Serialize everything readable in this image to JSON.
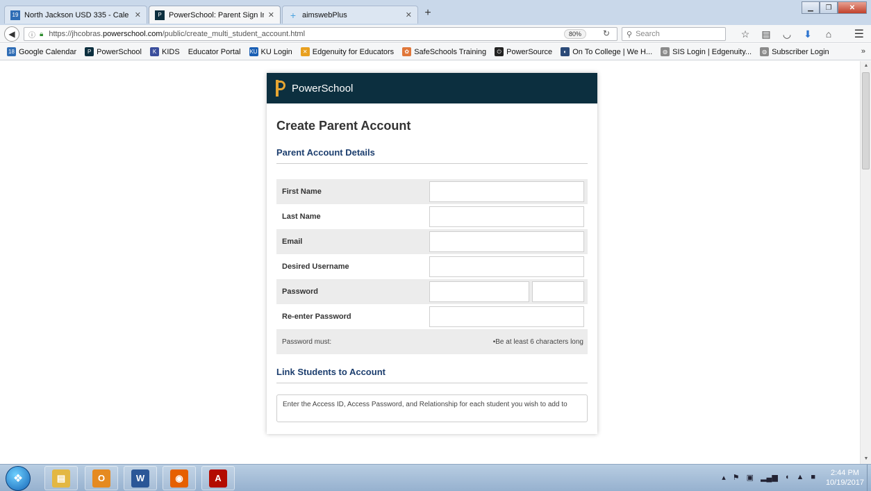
{
  "browser": {
    "tabs": [
      {
        "title": "North Jackson USD 335 - Cale",
        "favicon": "calendar-icon",
        "favicon_text": "19",
        "favicon_color": "#2f6db5",
        "active": false
      },
      {
        "title": "PowerSchool: Parent Sign In",
        "favicon": "powerschool-icon",
        "favicon_text": "P",
        "favicon_color": "#0c2f3f",
        "active": true
      },
      {
        "title": "aimswebPlus",
        "favicon": "aimsweb-icon",
        "favicon_text": "+",
        "favicon_color": "#4aa3df",
        "active": false
      }
    ],
    "new_tab_label": "+",
    "url_prefix": "https://jhcobras.",
    "url_domain": "powerschool.com",
    "url_path": "/public/create_multi_student_account.html",
    "zoom": "80%",
    "search_placeholder": "Search",
    "bookmarks": [
      {
        "label": "Google Calendar",
        "icon": "calendar-icon",
        "icon_text": "18",
        "color": "#2f6db5"
      },
      {
        "label": "PowerSchool",
        "icon": "powerschool-icon",
        "icon_text": "P",
        "color": "#0c2f3f"
      },
      {
        "label": "KIDS",
        "icon": "kids-icon",
        "icon_text": "K",
        "color": "#3a4e9c"
      },
      {
        "label": "Educator Portal",
        "icon": "",
        "icon_text": "",
        "color": ""
      },
      {
        "label": "KU Login",
        "icon": "ku-icon",
        "icon_text": "KU",
        "color": "#1a5fb4"
      },
      {
        "label": "Edgenuity for Educators",
        "icon": "edgenuity-icon",
        "icon_text": "✕",
        "color": "#e8a020"
      },
      {
        "label": "SafeSchools Training",
        "icon": "safeschools-icon",
        "icon_text": "✿",
        "color": "#e0773a"
      },
      {
        "label": "PowerSource",
        "icon": "power-icon",
        "icon_text": "⏻",
        "color": "#222222"
      },
      {
        "label": "On To College | We H...",
        "icon": "college-icon",
        "icon_text": "◐",
        "color": "#2b4a78"
      },
      {
        "label": "SIS Login | Edgenuity...",
        "icon": "globe-icon",
        "icon_text": "◍",
        "color": "#8a8a8a"
      },
      {
        "label": "Subscriber Login",
        "icon": "globe-icon",
        "icon_text": "◍",
        "color": "#8a8a8a"
      }
    ],
    "bookmarks_overflow": "»"
  },
  "page": {
    "brand": "PowerSchool",
    "title": "Create Parent Account",
    "section_account": "Parent Account Details",
    "fields": {
      "first_name": "First Name",
      "last_name": "Last Name",
      "email": "Email",
      "username": "Desired Username",
      "password": "Password",
      "reenter_password": "Re-enter Password"
    },
    "password_rules_label": "Password must:",
    "password_rules_text": "•Be at least 6 characters long",
    "section_students": "Link Students to Account",
    "students_info": "Enter the Access ID, Access Password, and Relationship for each student you wish to add to"
  },
  "taskbar": {
    "time": "2:44 PM",
    "date": "10/19/2017",
    "apps": [
      {
        "name": "explorer-icon",
        "glyph": "▤",
        "color": "#e3b743"
      },
      {
        "name": "outlook-icon",
        "glyph": "O",
        "color": "#e58a21"
      },
      {
        "name": "word-icon",
        "glyph": "W",
        "color": "#2b5797"
      },
      {
        "name": "firefox-icon",
        "glyph": "◉",
        "color": "#e66000"
      },
      {
        "name": "acrobat-icon",
        "glyph": "A",
        "color": "#b30b00"
      }
    ]
  }
}
